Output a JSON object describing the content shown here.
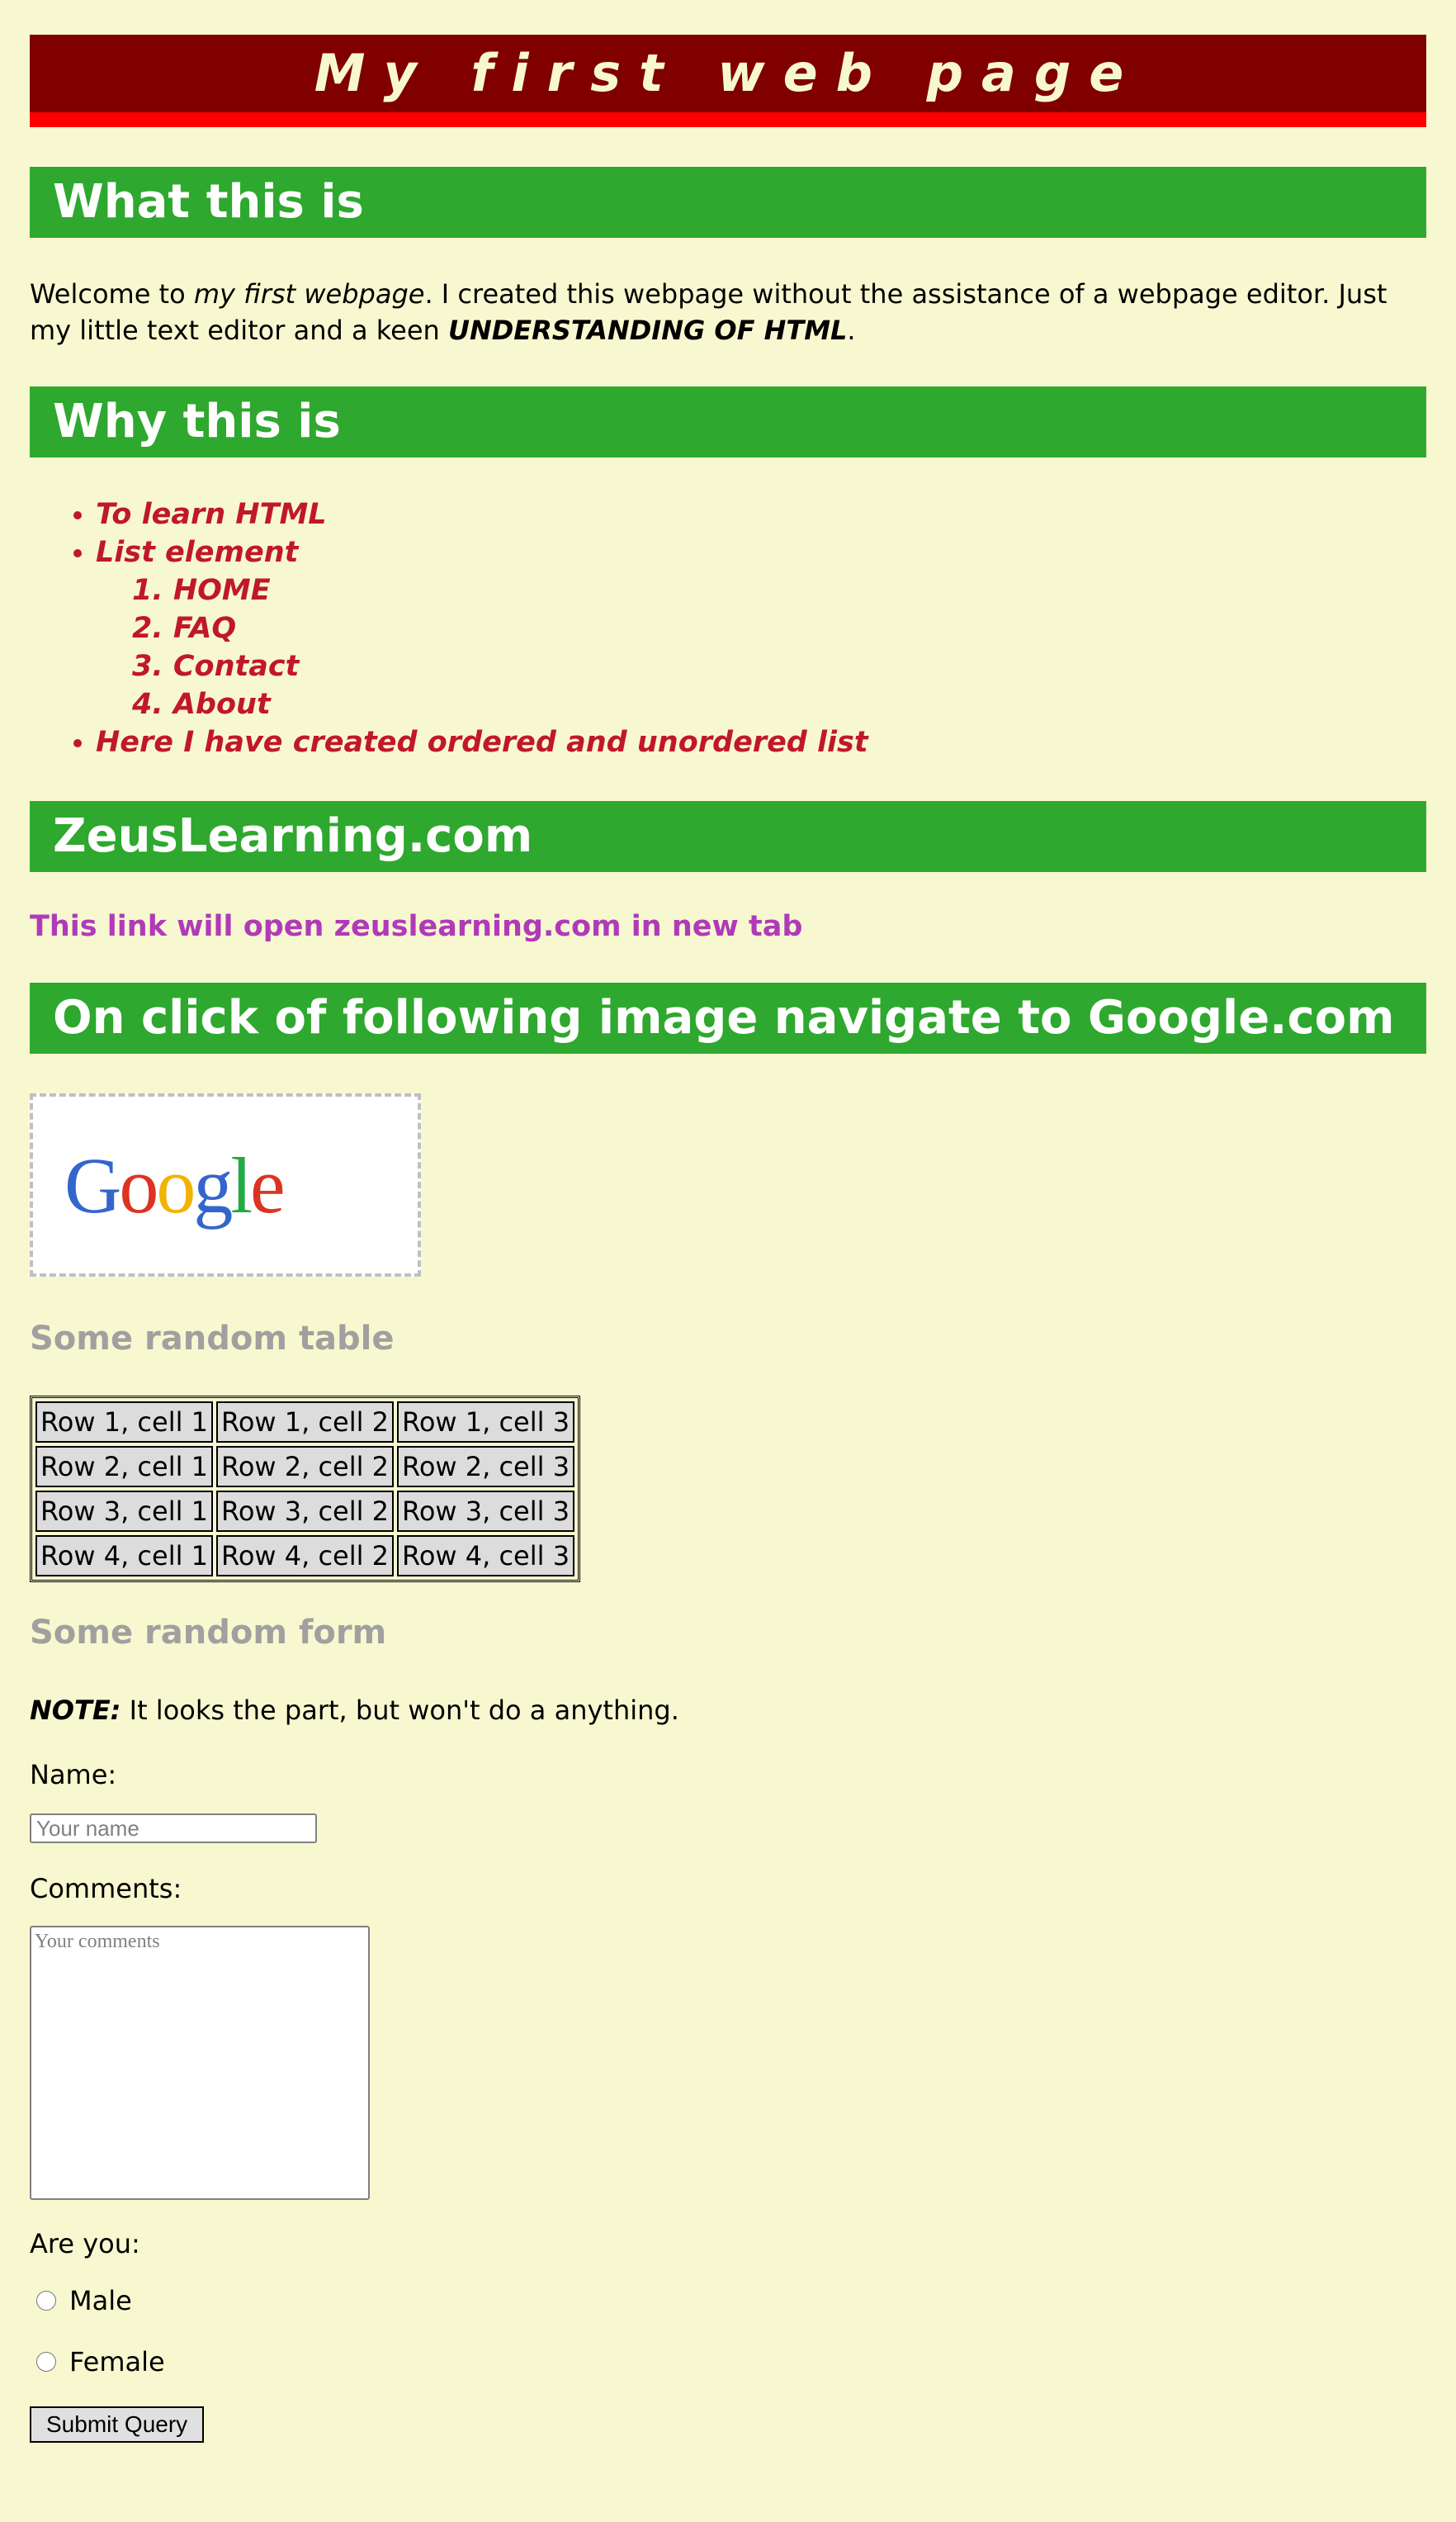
{
  "header": {
    "title": "My first web page"
  },
  "what": {
    "heading": "What this is",
    "intro_pre": "Welcome to ",
    "intro_em": "my first webpage",
    "intro_mid": ". I created this webpage without the assistance of a webpage editor. Just my little text editor and a keen ",
    "intro_strong": "UNDERSTANDING OF HTML",
    "intro_end": "."
  },
  "why": {
    "heading": "Why this is",
    "items": [
      "To learn HTML",
      "List element",
      "Here I have created ordered and unordered list"
    ],
    "sub_items": [
      "1. HOME",
      "2. FAQ",
      "3. Contact",
      "4. About"
    ]
  },
  "zeus": {
    "heading": "ZeusLearning.com",
    "link_text": "This link will open zeuslearning.com in new tab"
  },
  "google": {
    "heading": "On click of following image navigate to Google.com",
    "logo_letters": [
      "G",
      "o",
      "o",
      "g",
      "l",
      "e"
    ],
    "logo_colors": [
      "#3366cc",
      "#dd3322",
      "#f0b400",
      "#3366cc",
      "#22aa44",
      "#dd3322"
    ]
  },
  "table": {
    "heading": "Some random table",
    "rows": [
      [
        "Row 1, cell 1",
        "Row 1, cell 2",
        "Row 1, cell 3"
      ],
      [
        "Row 2, cell 1",
        "Row 2, cell 2",
        "Row 2, cell 3"
      ],
      [
        "Row 3, cell 1",
        "Row 3, cell 2",
        "Row 3, cell 3"
      ],
      [
        "Row 4, cell 1",
        "Row 4, cell 2",
        "Row 4, cell 3"
      ]
    ]
  },
  "form": {
    "heading": "Some random form",
    "note_label": "NOTE:",
    "note_text": " It looks the part, but won't do a anything.",
    "name_label": "Name:",
    "name_placeholder": "Your name",
    "comments_label": "Comments:",
    "comments_placeholder": "Your comments",
    "gender_label": "Are you:",
    "male_label": "Male",
    "female_label": "Female",
    "submit_label": "Submit Query"
  }
}
